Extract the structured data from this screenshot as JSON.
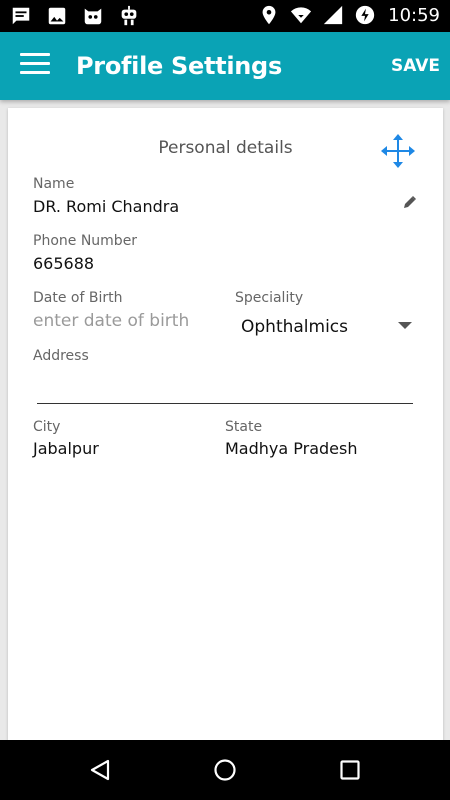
{
  "status_bar": {
    "time": "10:59",
    "left_icons": [
      "chat-icon",
      "image-icon",
      "cat-face-icon",
      "robot-icon"
    ],
    "right_icons": [
      "location-icon",
      "wifi-icon",
      "signal-icon",
      "data-saver-icon"
    ]
  },
  "appbar": {
    "title": "Profile Settings",
    "save_label": "SAVE",
    "color": "#0aa3b5"
  },
  "form": {
    "section_title": "Personal details",
    "name": {
      "label": "Name",
      "value": "DR. Romi Chandra"
    },
    "phone": {
      "label": "Phone Number",
      "value": "665688"
    },
    "dob": {
      "label": "Date of Birth",
      "placeholder": "enter date of birth"
    },
    "speciality": {
      "label": "Speciality",
      "value": "Ophthalmics"
    },
    "address": {
      "label": "Address",
      "value": ""
    },
    "city": {
      "label": "City",
      "value": "Jabalpur"
    },
    "state": {
      "label": "State",
      "value": "Madhya Pradesh"
    }
  },
  "nav_bar": {
    "icons": [
      "back-icon",
      "home-icon",
      "recents-icon"
    ]
  }
}
